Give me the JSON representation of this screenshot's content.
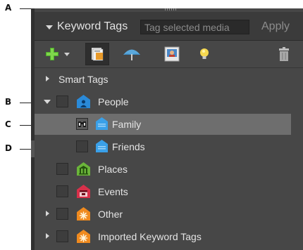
{
  "callouts": {
    "a": "A",
    "b": "B",
    "c": "C",
    "d": "D"
  },
  "header": {
    "title": "Keyword Tags",
    "search_placeholder": "Tag selected media",
    "apply_label": "Apply"
  },
  "toolbar": {
    "icons": [
      "add-icon",
      "dropdown-arrow-icon",
      "edit-tag-icon",
      "umbrella-icon",
      "photo-icon",
      "lightbulb-icon",
      "trash-icon"
    ]
  },
  "tree": {
    "smart_tags": "Smart Tags",
    "people": "People",
    "family": "Family",
    "friends": "Friends",
    "places": "Places",
    "events": "Events",
    "other": "Other",
    "imported": "Imported Keyword Tags"
  },
  "colors": {
    "panel_bg": "#474747",
    "selected_row": "#6e6e6e",
    "people_tag": "#2a8ad8",
    "places_tag": "#6bb53a",
    "events_tag": "#d8304a",
    "other_tag": "#f08a1e",
    "imported_tag": "#f08a1e"
  }
}
